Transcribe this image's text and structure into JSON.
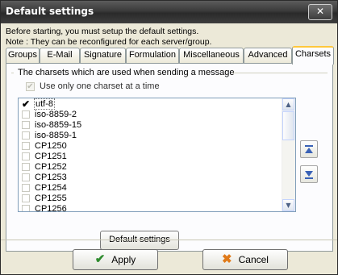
{
  "window": {
    "title": "Default settings",
    "close_glyph": "✕"
  },
  "intro": {
    "line1": "Before starting, you must setup the default settings.",
    "line2": "Note : They can be reconfigured for each server/group."
  },
  "tabs": [
    {
      "label": "Groups"
    },
    {
      "label": "E-Mail"
    },
    {
      "label": "Signature"
    },
    {
      "label": "Formulation"
    },
    {
      "label": "Miscellaneous"
    },
    {
      "label": "Advanced"
    },
    {
      "label": "Charsets",
      "active": true
    }
  ],
  "charsets_group": {
    "legend": "The charsets which are used when sending a message",
    "single_charset_label": "Use only one charset at a time",
    "single_charset_checked": true
  },
  "charset_list": [
    {
      "label": "utf-8",
      "checked": true,
      "selected": true
    },
    {
      "label": "iso-8859-2",
      "checked": false
    },
    {
      "label": "iso-8859-15",
      "checked": false
    },
    {
      "label": "iso-8859-1",
      "checked": false
    },
    {
      "label": "CP1250",
      "checked": false
    },
    {
      "label": "CP1251",
      "checked": false
    },
    {
      "label": "CP1252",
      "checked": false
    },
    {
      "label": "CP1253",
      "checked": false
    },
    {
      "label": "CP1254",
      "checked": false
    },
    {
      "label": "CP1255",
      "checked": false
    },
    {
      "label": "CP1256",
      "checked": false
    }
  ],
  "buttons": {
    "default_settings": "Default settings",
    "apply": "Apply",
    "cancel": "Cancel"
  },
  "icons": {
    "move_up": "move-up-icon",
    "move_down": "move-down-icon",
    "apply": "check-icon",
    "cancel": "cancel-x-icon"
  },
  "colors": {
    "title_bar": "#3a3a3a",
    "active_tab_accent": "#ffc73c",
    "dialog_bg": "#ece9d8"
  }
}
